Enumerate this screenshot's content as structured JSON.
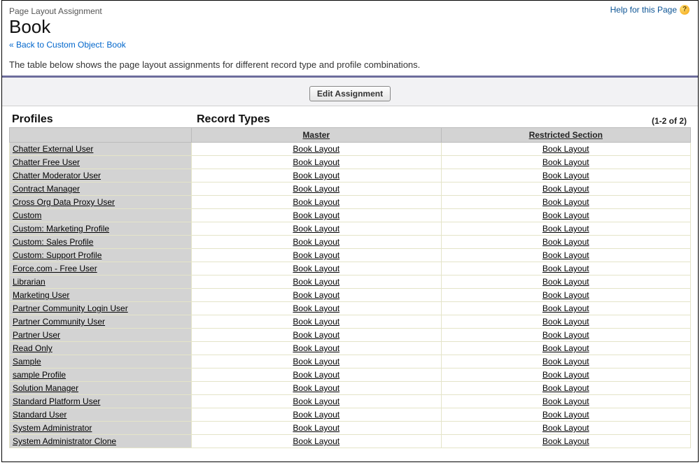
{
  "header": {
    "section_label": "Page Layout Assignment",
    "title": "Book",
    "back_link": "« Back to Custom Object: Book",
    "help_label": "Help for this Page"
  },
  "description": "The table below shows the page layout assignments for different record type and profile combinations.",
  "toolbar": {
    "edit_assignment": "Edit Assignment"
  },
  "table": {
    "profiles_heading": "Profiles",
    "record_types_heading": "Record Types",
    "pager": "(1-2 of 2)",
    "record_types": [
      {
        "label": "Master"
      },
      {
        "label": "Restricted Section"
      }
    ],
    "default_layout": "Book Layout",
    "profiles": [
      {
        "name": "Chatter External User"
      },
      {
        "name": "Chatter Free User"
      },
      {
        "name": "Chatter Moderator User"
      },
      {
        "name": "Contract Manager"
      },
      {
        "name": "Cross Org Data Proxy User"
      },
      {
        "name": "Custom"
      },
      {
        "name": "Custom: Marketing Profile"
      },
      {
        "name": "Custom: Sales Profile"
      },
      {
        "name": "Custom: Support Profile"
      },
      {
        "name": "Force.com - Free User"
      },
      {
        "name": "Librarian"
      },
      {
        "name": "Marketing User"
      },
      {
        "name": "Partner Community Login User"
      },
      {
        "name": "Partner Community User"
      },
      {
        "name": "Partner User"
      },
      {
        "name": "Read Only"
      },
      {
        "name": "Sample"
      },
      {
        "name": "sample Profile"
      },
      {
        "name": "Solution Manager"
      },
      {
        "name": "Standard Platform User"
      },
      {
        "name": "Standard User"
      },
      {
        "name": "System Administrator"
      },
      {
        "name": "System Administrator Clone"
      }
    ]
  }
}
